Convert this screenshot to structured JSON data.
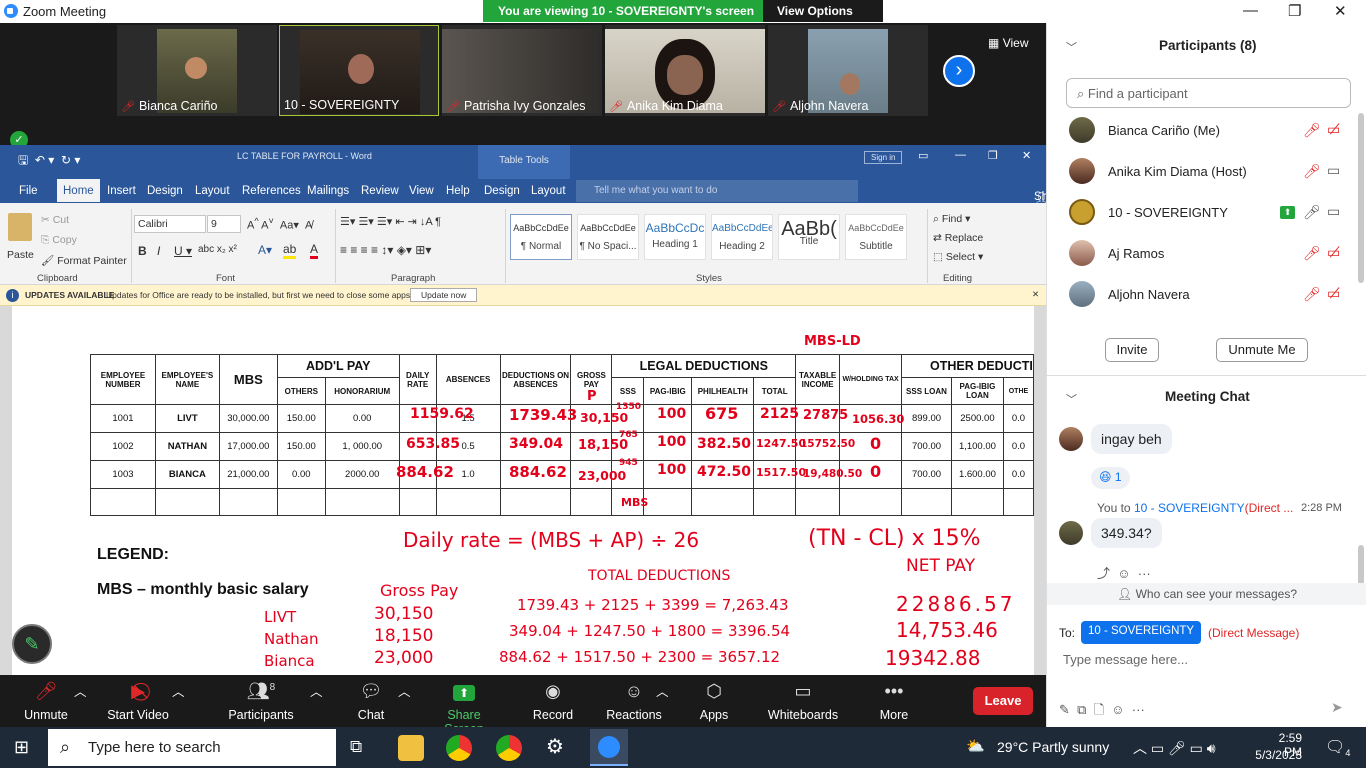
{
  "window": {
    "title": "Zoom Meeting",
    "icons": [
      "minimize-icon",
      "restore-icon",
      "close-icon"
    ]
  },
  "banner": {
    "message": "You are viewing 10 - SOVEREIGNTY's screen",
    "options": "View Options"
  },
  "video_tiles": [
    {
      "name": "Bianca Cariño",
      "muted": true
    },
    {
      "name": "10 - SOVEREIGNTY",
      "muted": false,
      "active": true
    },
    {
      "name": "Patrisha Ivy Gonzales",
      "muted": true
    },
    {
      "name": "Anika Kim Diama",
      "muted": true
    },
    {
      "name": "Aljohn Navera",
      "muted": true
    }
  ],
  "view_button": "View",
  "word": {
    "doc_title": "LC TABLE FOR PAYROLL - Word",
    "table_tools": "Table Tools",
    "sign_in": "Sign in",
    "tabs": [
      "File",
      "Home",
      "Insert",
      "Design",
      "Layout",
      "References",
      "Mailings",
      "Review",
      "View",
      "Help",
      "Design",
      "Layout"
    ],
    "active_tab": "Home",
    "tell_me": "Tell me what you want to do",
    "share": "Share",
    "clipboard": {
      "paste": "Paste",
      "cut": "Cut",
      "copy": "Copy",
      "format_painter": "Format Painter",
      "label": "Clipboard"
    },
    "font": {
      "name": "Calibri",
      "size": "9",
      "label": "Font"
    },
    "paragraph_label": "Paragraph",
    "styles": [
      {
        "sample": "AaBbCcDdEe",
        "label": "¶ Normal"
      },
      {
        "sample": "AaBbCcDdEe",
        "label": "¶ No Spaci..."
      },
      {
        "sample": "AaBbCcDc",
        "label": "Heading 1"
      },
      {
        "sample": "AaBbCcDdEe",
        "label": "Heading 2"
      },
      {
        "sample": "AaBb(",
        "label": "Title"
      },
      {
        "sample": "AaBbCcDdEe",
        "label": "Subtitle"
      }
    ],
    "styles_label": "Styles",
    "editing": {
      "find": "Find",
      "replace": "Replace",
      "select": "Select",
      "label": "Editing"
    },
    "update": {
      "title": "UPDATES AVAILABLE",
      "text": "Updates for Office are ready to be installed, but first we need to close some apps.",
      "button": "Update now"
    }
  },
  "payroll_table": {
    "headers": {
      "employee_number": "EMPLOYEE NUMBER",
      "employee_name": "EMPLOYEE'S NAME",
      "mbs": "MBS",
      "addl_pay": "ADD'L PAY",
      "others": "OTHERS",
      "honorarium": "HONORARIUM",
      "daily_rate": "DAILY RATE",
      "absences": "ABSENCES",
      "deductions_on_absences": "DEDUCTIONS ON ABSENCES",
      "gross_pay": "GROSS PAY",
      "legal_deductions": "LEGAL DEDUCTIONS",
      "sss": "SSS",
      "pagibig": "PAG-IBIG",
      "philhealth": "PHILHEALTH",
      "total": "TOTAL",
      "taxable_income": "TAXABLE INCOME",
      "withholding_tax": "W/HOLDING TAX",
      "other_deductions": "OTHER DEDUCTI",
      "sss_loan": "SSS LOAN",
      "pagibig_loan": "PAG-IBIG LOAN",
      "other": "OTHE"
    },
    "rows": [
      {
        "num": "1001",
        "name": "LIVT",
        "mbs": "30,000.00",
        "others": "150.00",
        "honorarium": "0.00",
        "absences": "1.5",
        "sss_loan": "899.00",
        "pagibig_loan": "2500.00",
        "other": "0.0"
      },
      {
        "num": "1002",
        "name": "NATHAN",
        "mbs": "17,000.00",
        "others": "150.00",
        "honorarium": "1, 000.00",
        "absences": "0.5",
        "sss_loan": "700.00",
        "pagibig_loan": "1,100.00",
        "other": "0.0"
      },
      {
        "num": "1003",
        "name": "BIANCA",
        "mbs": "21,000.00",
        "others": "0.00",
        "honorarium": "2000.00",
        "absences": "1.0",
        "sss_loan": "700.00",
        "pagibig_loan": "1.600.00",
        "other": "0.0"
      }
    ]
  },
  "handwriting": {
    "mbs_ld": "MBS-LD",
    "gross_p": "P",
    "r1": {
      "daily": "1159.62",
      "ded": "1739.43",
      "gross": "30,150",
      "sss": "1350",
      "pag": "100",
      "phil": "675",
      "total": "2125",
      "taxable": "27875",
      "wtax": "1056.30"
    },
    "r2": {
      "daily": "653.85",
      "ded": "349.04",
      "gross": "18,150",
      "sss": "765",
      "pag": "100",
      "phil": "382.50",
      "total": "1247.50",
      "taxable": "15752.50",
      "wtax": "0"
    },
    "r3": {
      "daily": "884.62",
      "ded": "884.62",
      "gross": "23,000",
      "sss": "945",
      "pag": "100",
      "phil": "472.50",
      "total": "1517.50",
      "taxable": "19,480.50",
      "wtax": "0"
    },
    "mbs_note": "MBS",
    "daily_formula": "Daily rate = (MBS + AP) ÷ 26",
    "tax_formula": "(TN - CL) x 15%",
    "gross_pay": "Gross Pay",
    "total_deductions": "TOTAL DEDUCTIONS",
    "net_pay": "NET PAY",
    "names": [
      "LIVT",
      "Nathan",
      "Bianca"
    ],
    "gross_values": [
      "30,150",
      "18,150",
      "23,000"
    ],
    "deduction_sums": [
      "1739.43 + 2125 + 3399 = 7,263.43",
      "349.04 + 1247.50 + 1800 = 3396.54",
      "884.62 + 1517.50 + 2300 = 3657.12"
    ],
    "net_values": [
      "22886.57",
      "14,753.46",
      "19342.88"
    ]
  },
  "legend": {
    "title": "LEGEND:",
    "mbs": "MBS – monthly basic salary"
  },
  "toolbar": {
    "unmute": "Unmute",
    "start_video": "Start Video",
    "participants": "Participants",
    "participants_count": "8",
    "chat": "Chat",
    "share_screen": "Share Screen",
    "record": "Record",
    "reactions": "Reactions",
    "apps": "Apps",
    "whiteboards": "Whiteboards",
    "more": "More",
    "leave": "Leave"
  },
  "participants": {
    "title": "Participants (8)",
    "search_placeholder": "Find a participant",
    "list": [
      {
        "name": "Bianca Cariño (Me)",
        "mic_muted": true,
        "cam_off": true
      },
      {
        "name": "Anika Kim Diama (Host)",
        "mic_muted": true,
        "cam_off": false
      },
      {
        "name": "10 - SOVEREIGNTY",
        "mic_muted": false,
        "cam_off": false,
        "sharing": true
      },
      {
        "name": "Aj Ramos",
        "mic_muted": true,
        "cam_off": true
      },
      {
        "name": "Aljohn Navera",
        "mic_muted": true,
        "cam_off": true
      }
    ],
    "invite": "Invite",
    "unmute_me": "Unmute Me"
  },
  "chat": {
    "title": "Meeting Chat",
    "messages": [
      {
        "text": "ingay beh",
        "reaction": "😆",
        "reaction_count": "1"
      },
      {
        "from": "You to",
        "to": "10 - SOVEREIGNTY",
        "dm": "(Direct ...",
        "time": "2:28 PM",
        "text": "349.34?"
      }
    ],
    "who_can_see": "Who can see your messages?",
    "to_label": "To:",
    "to_value": "10 - SOVEREIGNTY",
    "direct_message": "(Direct Message)",
    "input_placeholder": "Type message here..."
  },
  "taskbar": {
    "search_placeholder": "Type here to search",
    "weather": "29°C  Partly sunny",
    "time": "2:59 PM",
    "date": "5/3/2023",
    "notifications": "4"
  }
}
